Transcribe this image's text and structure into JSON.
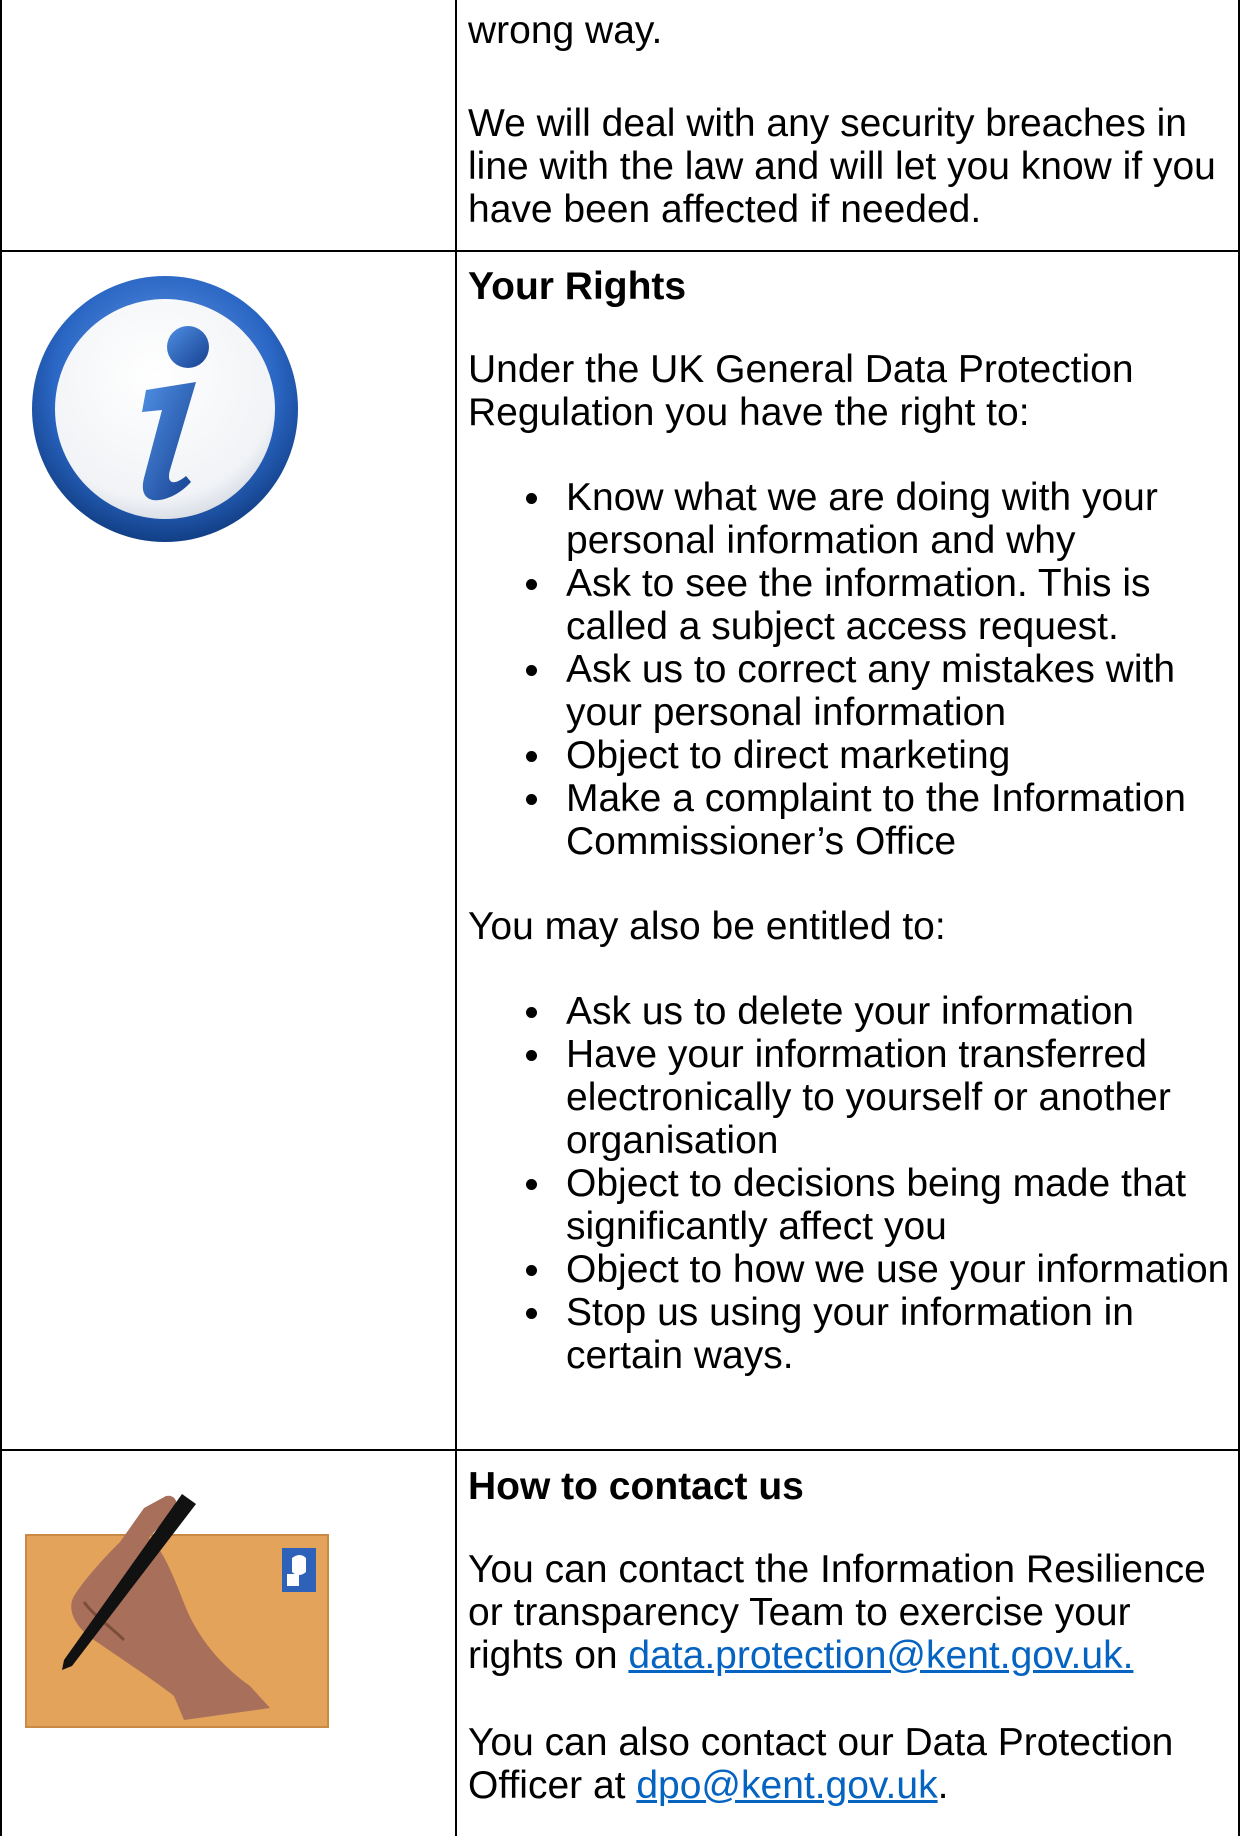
{
  "section_top": {
    "fragment": "wrong way.",
    "paragraph": "We will deal with any security breaches in line with the law and will let you know if you have been affected if needed."
  },
  "rights": {
    "icon": "info-icon",
    "heading": "Your Rights",
    "intro": "Under the UK General Data Protection Regulation you have the right to:",
    "list1": [
      "Know what we are doing with your personal information and why",
      "Ask to see the information. This is called a subject access request.",
      "Ask us to correct any mistakes with your personal information",
      "Object to direct marketing",
      "Make a complaint to the Information Commissioner’s Office"
    ],
    "also": "You may also be entitled to:",
    "list2": [
      "Ask us to delete your information",
      "Have your information transferred electronically to yourself or another organisation",
      "Object to decisions being made that significantly affect you",
      "Object to how we use your information",
      "Stop us using your information in certain ways."
    ]
  },
  "contact": {
    "icon": "letter-writing-icon",
    "heading": "How to contact us",
    "p1_text": "You can contact the Information Resilience or transparency Team to exercise your rights on ",
    "p1_link": "data.protection@kent.gov.uk.",
    "p2_text": "You can also contact our Data Protection Officer at ",
    "p2_link": "dpo@kent.gov.uk",
    "p2_end": "."
  },
  "colors": {
    "link": "#0563c1",
    "info_ring": "#2a66c4",
    "envelope": "#e4a35a"
  }
}
